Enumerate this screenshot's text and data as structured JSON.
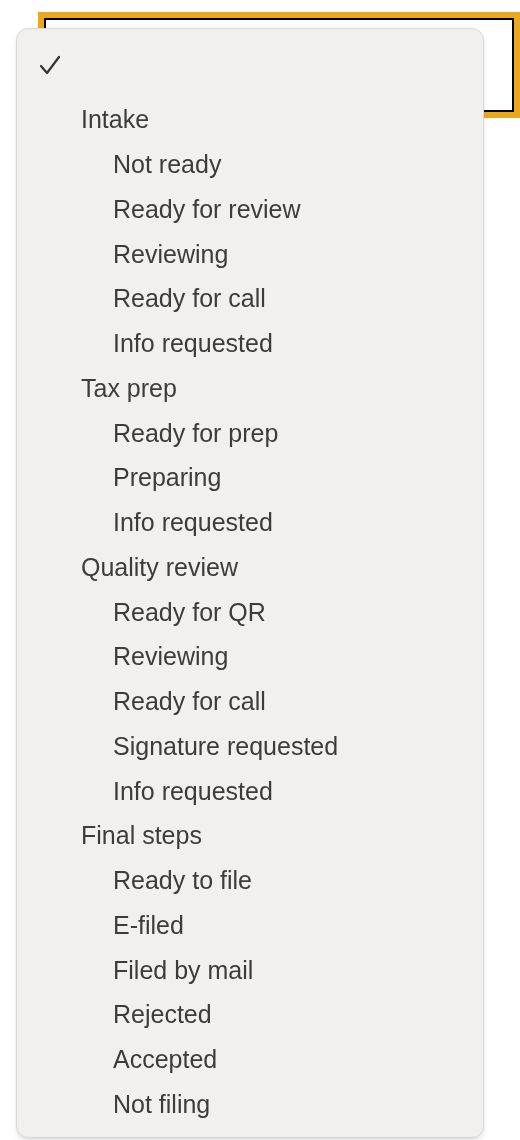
{
  "select": {
    "focused": true
  },
  "menu": {
    "options": [
      {
        "selected": true
      },
      {
        "label": "Intake",
        "children": [
          {
            "label": "Not ready",
            "selected": false
          },
          {
            "label": "Ready for review",
            "selected": false
          },
          {
            "label": "Reviewing",
            "selected": false
          },
          {
            "label": "Ready for call",
            "selected": false
          },
          {
            "label": "Info requested",
            "selected": false
          }
        ]
      },
      {
        "label": "Tax prep",
        "children": [
          {
            "label": "Ready for prep",
            "selected": false
          },
          {
            "label": "Preparing",
            "selected": false
          },
          {
            "label": "Info requested",
            "selected": false
          }
        ]
      },
      {
        "label": "Quality review",
        "children": [
          {
            "label": "Ready for QR",
            "selected": false
          },
          {
            "label": "Reviewing",
            "selected": false
          },
          {
            "label": "Ready for call",
            "selected": false
          },
          {
            "label": "Signature requested",
            "selected": false
          },
          {
            "label": "Info requested",
            "selected": false
          }
        ]
      },
      {
        "label": "Final steps",
        "children": [
          {
            "label": "Ready to file",
            "selected": false
          },
          {
            "label": "E-filed",
            "selected": false
          },
          {
            "label": "Filed by mail",
            "selected": false
          },
          {
            "label": "Rejected",
            "selected": false
          },
          {
            "label": "Accepted",
            "selected": false
          },
          {
            "label": "Not filing",
            "selected": false
          }
        ]
      }
    ]
  }
}
